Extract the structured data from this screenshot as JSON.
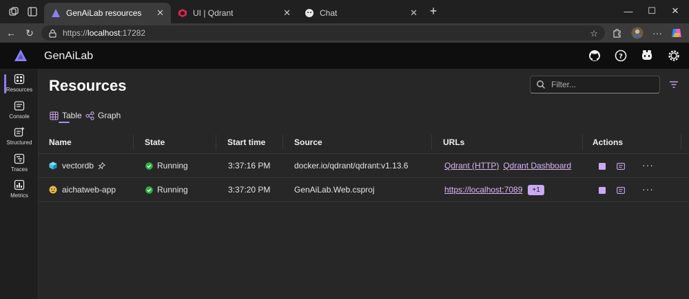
{
  "browser": {
    "tabs": [
      {
        "label": "GenAiLab resources",
        "active": true
      },
      {
        "label": "UI | Qdrant",
        "active": false
      },
      {
        "label": "Chat",
        "active": false
      }
    ],
    "url": {
      "protocol": "https://",
      "host": "localhost",
      "port": ":17282"
    }
  },
  "app": {
    "title": "GenAiLab",
    "accent": "#8b7ff0",
    "nav": [
      {
        "label": "Resources",
        "icon": "resources-icon",
        "active": true
      },
      {
        "label": "Console",
        "icon": "console-icon"
      },
      {
        "label": "Structured",
        "icon": "structured-icon"
      },
      {
        "label": "Traces",
        "icon": "traces-icon"
      },
      {
        "label": "Metrics",
        "icon": "metrics-icon"
      }
    ]
  },
  "page": {
    "title": "Resources",
    "filter_placeholder": "Filter...",
    "view_tabs": [
      {
        "label": "Table",
        "active": true
      },
      {
        "label": "Graph",
        "active": false
      }
    ]
  },
  "table": {
    "columns": [
      "Name",
      "State",
      "Start time",
      "Source",
      "URLs",
      "Actions"
    ],
    "rows": [
      {
        "name": "vectordb",
        "icon": "container-icon",
        "pinned": true,
        "state": "Running",
        "start_time": "3:37:16 PM",
        "source": "docker.io/qdrant/qdrant:v1.13.6",
        "urls": [
          "Qdrant (HTTP)",
          "Qdrant Dashboard"
        ],
        "extra_urls": ""
      },
      {
        "name": "aichatweb-app",
        "icon": "project-icon",
        "pinned": false,
        "state": "Running",
        "start_time": "3:37:20 PM",
        "source": "GenAiLab.Web.csproj",
        "urls": [
          "https://localhost:7089"
        ],
        "extra_urls": "+1"
      }
    ]
  },
  "colors": {
    "running": "#2fb344",
    "link": "#d9b8f5",
    "action": "#c9a9f2"
  }
}
